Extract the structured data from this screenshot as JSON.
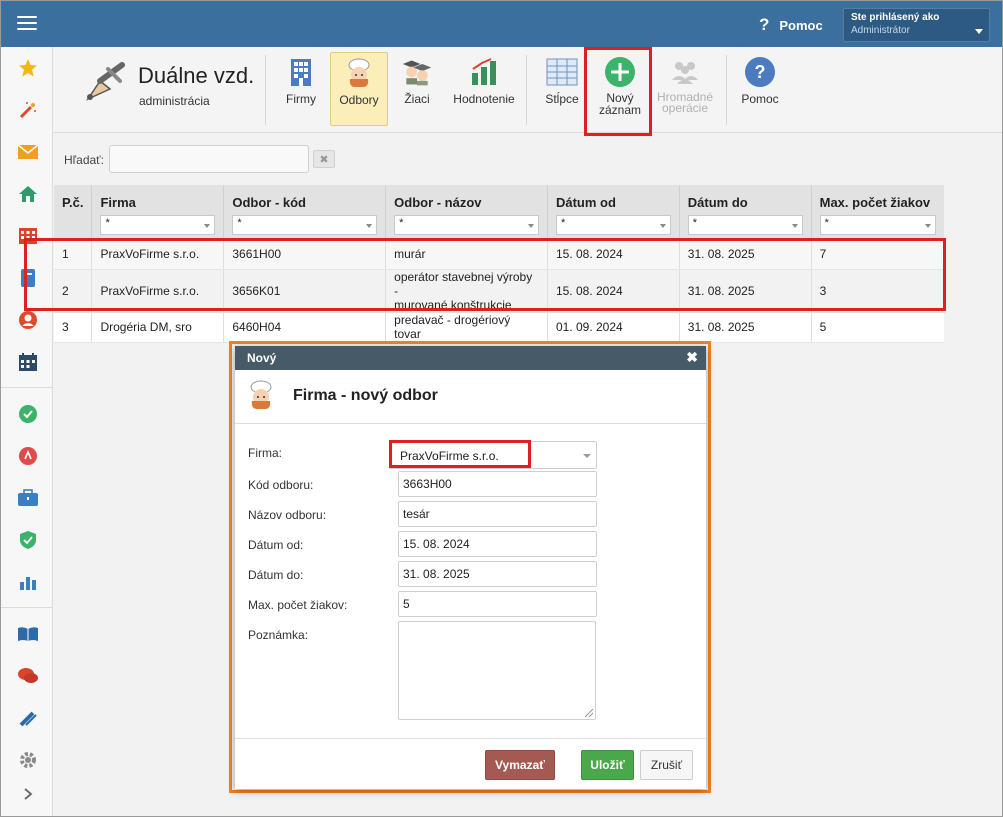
{
  "topbar": {
    "help_label": "Pomoc",
    "user_line1": "Ste prihlásený ako",
    "user_line2": "Administrátor"
  },
  "app": {
    "title": "Duálne vzd.",
    "subtitle": "administrácia"
  },
  "toolbar": {
    "firmy": "Firmy",
    "odbory": "Odbory",
    "ziaci": "Žiaci",
    "hodnotenie": "Hodnotenie",
    "stlpce": "Stĺpce",
    "novy_line1": "Nový",
    "novy_line2": "záznam",
    "hromadne_line1": "Hromadné",
    "hromadne_line2": "operácie",
    "pomoc": "Pomoc"
  },
  "search": {
    "label": "Hľadať:",
    "value": "",
    "clear": "✖"
  },
  "table": {
    "columns": [
      "P.č.",
      "Firma",
      "Odbor - kód",
      "Odbor - názov",
      "Dátum od",
      "Dátum do",
      "Max. počet žiakov"
    ],
    "filter_value": "*",
    "rows": [
      [
        "1",
        "PraxVoFirme s.r.o.",
        "3661H00",
        "murár",
        "15. 08. 2024",
        "31. 08. 2025",
        "7"
      ],
      [
        "2",
        "PraxVoFirme s.r.o.",
        "3656K01",
        "operátor stavebnej výroby - murované konštrukcie",
        "15. 08. 2024",
        "31. 08. 2025",
        "3"
      ],
      [
        "3",
        "Drogéria DM, sro",
        "6460H04",
        "predavač - drogériový tovar",
        "01. 09. 2024",
        "31. 08. 2025",
        "5"
      ]
    ],
    "row2_name_line1": "operátor stavebnej výroby -",
    "row2_name_line2": "murované konštrukcie"
  },
  "modal": {
    "header": "Nový",
    "close": "✖",
    "title": "Firma - nový odbor",
    "labels": {
      "firma": "Firma:",
      "kod": "Kód odboru:",
      "nazov": "Názov odboru:",
      "datum_od": "Dátum od:",
      "datum_do": "Dátum do:",
      "max": "Max. počet žiakov:",
      "poznamka": "Poznámka:"
    },
    "values": {
      "firma": "PraxVoFirme s.r.o.",
      "kod": "3663H00",
      "nazov": "tesár",
      "datum_od": "15. 08. 2024",
      "datum_do": "31. 08. 2025",
      "max": "5",
      "poznamka": ""
    },
    "buttons": {
      "delete": "Vymazať",
      "save": "Uložiť",
      "cancel": "Zrušiť"
    }
  },
  "colors": {
    "topbar": "#3a6f9e",
    "highlight_red": "#e0201e",
    "highlight_orange": "#f58220",
    "save": "#4aa84a",
    "delete": "#a45a52"
  }
}
